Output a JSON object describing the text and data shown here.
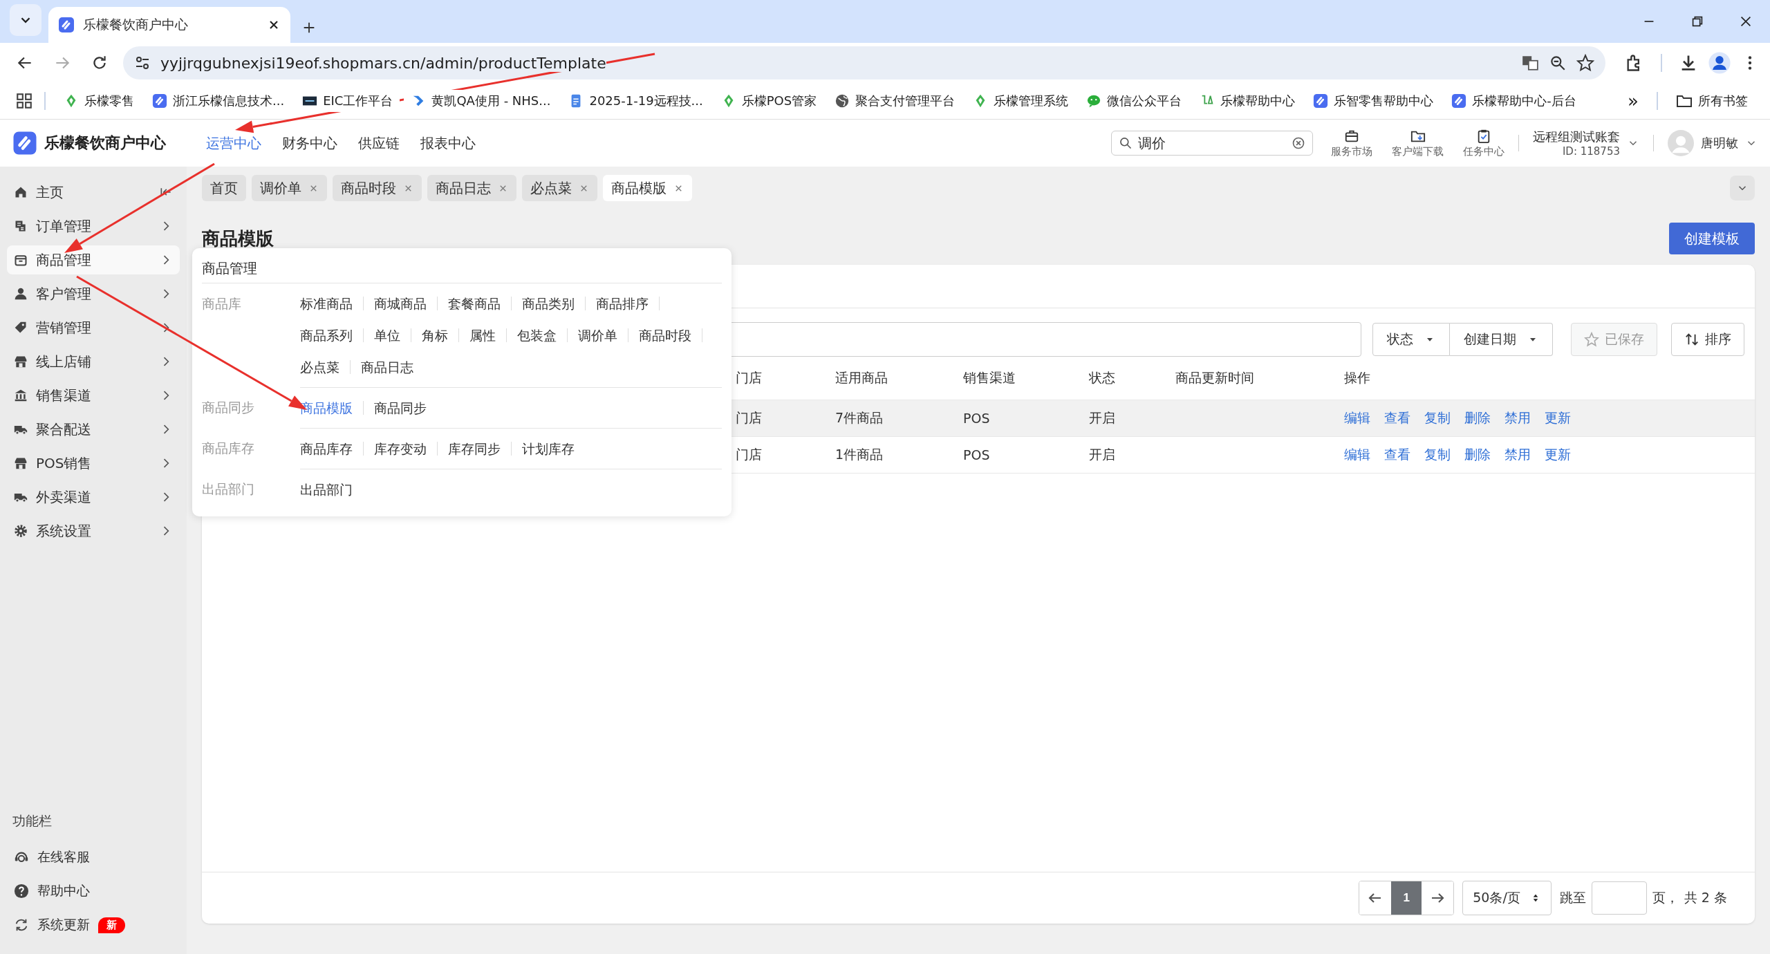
{
  "browser": {
    "tab": {
      "title": "乐檬餐饮商户中心"
    },
    "url": "yyjjrqgubnexjsi19eof.shopmars.cn/admin/productTemplate",
    "bookmarks": [
      {
        "label": "乐檬零售",
        "kind": "leaf"
      },
      {
        "label": "浙江乐檬信息技术...",
        "kind": "logo"
      },
      {
        "label": "EIC工作平台",
        "kind": "eic"
      },
      {
        "label": "黄凯QA使用 - NHS...",
        "kind": "jira"
      },
      {
        "label": "2025-1-19远程技...",
        "kind": "doc"
      },
      {
        "label": "乐檬POS管家",
        "kind": "leaf"
      },
      {
        "label": "聚合支付管理平台",
        "kind": "globe"
      },
      {
        "label": "乐檬管理系统",
        "kind": "leaf"
      },
      {
        "label": "微信公众平台",
        "kind": "wechat"
      },
      {
        "label": "乐檬帮助中心",
        "kind": "lemon"
      },
      {
        "label": "乐智零售帮助中心",
        "kind": "logo"
      },
      {
        "label": "乐檬帮助中心-后台",
        "kind": "logo"
      }
    ],
    "more": "»",
    "all_bookmarks": "所有书签"
  },
  "header": {
    "brand": "乐檬餐饮商户中心",
    "nav": [
      {
        "label": "运营中心",
        "selected": true
      },
      {
        "label": "财务中心",
        "selected": false
      },
      {
        "label": "供应链",
        "selected": false
      },
      {
        "label": "报表中心",
        "selected": false
      }
    ],
    "search": {
      "value": "调价"
    },
    "tools": [
      {
        "label": "服务市场"
      },
      {
        "label": "客户端下载"
      },
      {
        "label": "任务中心"
      }
    ],
    "account": {
      "name": "远程组测试账套",
      "id": "ID: 118753"
    },
    "user": {
      "name": "唐明敏"
    }
  },
  "sidebar": {
    "items": [
      {
        "label": "主页",
        "kind": "home",
        "selected": false
      },
      {
        "label": "订单管理",
        "kind": "menu",
        "selected": false
      },
      {
        "label": "商品管理",
        "kind": "menu",
        "selected": true
      },
      {
        "label": "客户管理",
        "kind": "menu",
        "selected": false
      },
      {
        "label": "营销管理",
        "kind": "menu",
        "selected": false
      },
      {
        "label": "线上店铺",
        "kind": "menu",
        "selected": false
      },
      {
        "label": "销售渠道",
        "kind": "menu",
        "selected": false
      },
      {
        "label": "聚合配送",
        "kind": "menu",
        "selected": false
      },
      {
        "label": "POS销售",
        "kind": "menu",
        "selected": false
      },
      {
        "label": "外卖渠道",
        "kind": "menu",
        "selected": false
      },
      {
        "label": "系统设置",
        "kind": "menu",
        "selected": false
      }
    ],
    "section_title": "功能栏",
    "tools": [
      {
        "label": "在线客服"
      },
      {
        "label": "帮助中心"
      },
      {
        "label": "系统更新",
        "badge": "新"
      }
    ]
  },
  "tabs": [
    {
      "label": "首页",
      "closable": false,
      "selected": false
    },
    {
      "label": "调价单",
      "closable": true,
      "selected": false
    },
    {
      "label": "商品时段",
      "closable": true,
      "selected": false
    },
    {
      "label": "商品日志",
      "closable": true,
      "selected": false
    },
    {
      "label": "必点菜",
      "closable": true,
      "selected": false
    },
    {
      "label": "商品模版",
      "closable": true,
      "selected": true
    }
  ],
  "page": {
    "title": "商品模版",
    "create_button": "创建模板"
  },
  "filters": {
    "status": "状态",
    "date": "创建日期",
    "saved": {
      "label": "已保存",
      "disabled": true
    },
    "sort": "排序"
  },
  "table": {
    "columns": [
      "门店",
      "适用商品",
      "销售渠道",
      "状态",
      "商品更新时间",
      "操作"
    ],
    "rows": [
      {
        "hovered": true,
        "column_1": "门店",
        "products": "7件商品",
        "channel": "POS",
        "status": "开启",
        "actions": [
          "编辑",
          "查看",
          "复制",
          "删除",
          "禁用",
          "更新"
        ]
      },
      {
        "hovered": false,
        "column_1": "门店",
        "products": "1件商品",
        "channel": "POS",
        "status": "开启",
        "actions": [
          "编辑",
          "查看",
          "复制",
          "删除",
          "禁用",
          "更新"
        ]
      }
    ]
  },
  "pagination": {
    "pages": [
      {
        "label": "1",
        "selected": true
      }
    ],
    "page_size": "50条/页",
    "jump_label": "跳至",
    "page_unit": "页，",
    "total": "共 2 条"
  },
  "popup": {
    "title": "商品管理",
    "groups": [
      {
        "label": "商品库",
        "links": [
          {
            "label": "标准商品",
            "selected": false
          },
          {
            "label": "商城商品",
            "selected": false
          },
          {
            "label": "套餐商品",
            "selected": false
          },
          {
            "label": "商品类别",
            "selected": false
          },
          {
            "label": "商品排序",
            "selected": false
          },
          {
            "label": "商品系列",
            "selected": false
          },
          {
            "label": "单位",
            "selected": false
          },
          {
            "label": "角标",
            "selected": false
          },
          {
            "label": "属性",
            "selected": false
          },
          {
            "label": "包装盒",
            "selected": false
          },
          {
            "label": "调价单",
            "selected": false
          },
          {
            "label": "商品时段",
            "selected": false
          },
          {
            "label": "必点菜",
            "selected": false
          },
          {
            "label": "商品日志",
            "selected": false
          }
        ]
      },
      {
        "label": "商品同步",
        "links": [
          {
            "label": "商品模版",
            "selected": true
          },
          {
            "label": "商品同步",
            "selected": false
          }
        ]
      },
      {
        "label": "商品库存",
        "links": [
          {
            "label": "商品库存",
            "selected": false
          },
          {
            "label": "库存变动",
            "selected": false
          },
          {
            "label": "库存同步",
            "selected": false
          },
          {
            "label": "计划库存",
            "selected": false
          }
        ]
      },
      {
        "label": "出品部门",
        "links": [
          {
            "label": "出品部门",
            "selected": false
          }
        ]
      }
    ]
  }
}
